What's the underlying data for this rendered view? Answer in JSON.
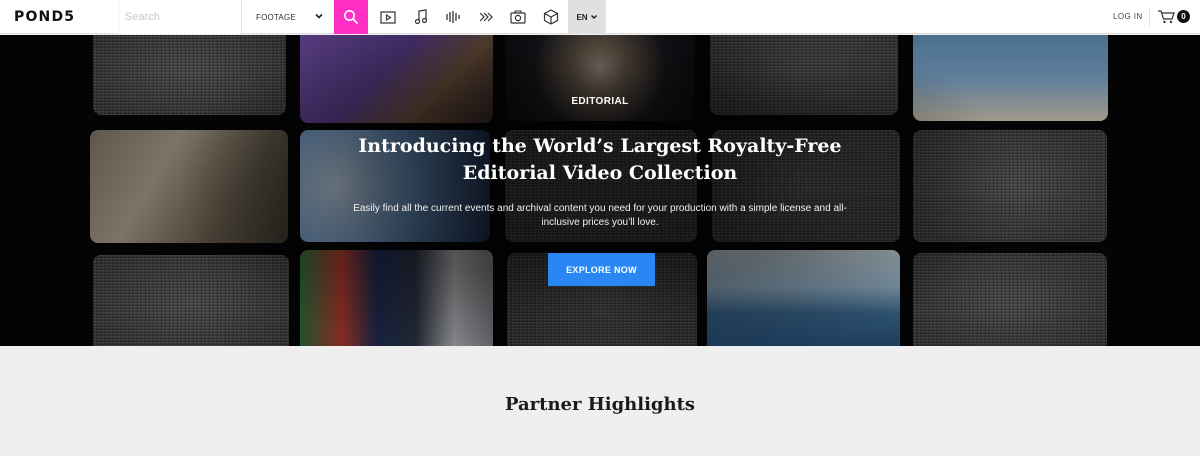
{
  "brand": {
    "logo_text": "POND5"
  },
  "search": {
    "placeholder": "Search"
  },
  "media_select": {
    "selected": "FOOTAGE"
  },
  "media_types": [
    {
      "icon": "video-icon"
    },
    {
      "icon": "music-icon"
    },
    {
      "icon": "sound-effects-icon"
    },
    {
      "icon": "after-effects-icon"
    },
    {
      "icon": "photo-icon"
    },
    {
      "icon": "3d-model-icon"
    }
  ],
  "language": {
    "code": "EN"
  },
  "account": {
    "login_label": "LOG IN"
  },
  "cart": {
    "count": "0"
  },
  "hero": {
    "eyebrow": "EDITORIAL",
    "title": "Introducing the World’s Largest Royalty-Free Editorial Video Collection",
    "subtitle": "Easily find all the current events and archival content you need for your production with a simple license and all-inclusive prices you’ll love.",
    "cta_label": "EXPLORE NOW"
  },
  "partner": {
    "heading": "Partner Highlights"
  },
  "colors": {
    "accent_search": "#ff2ec4",
    "cta": "#2a86f3",
    "hero_bg": "#050507",
    "section_bg": "#efefef"
  }
}
